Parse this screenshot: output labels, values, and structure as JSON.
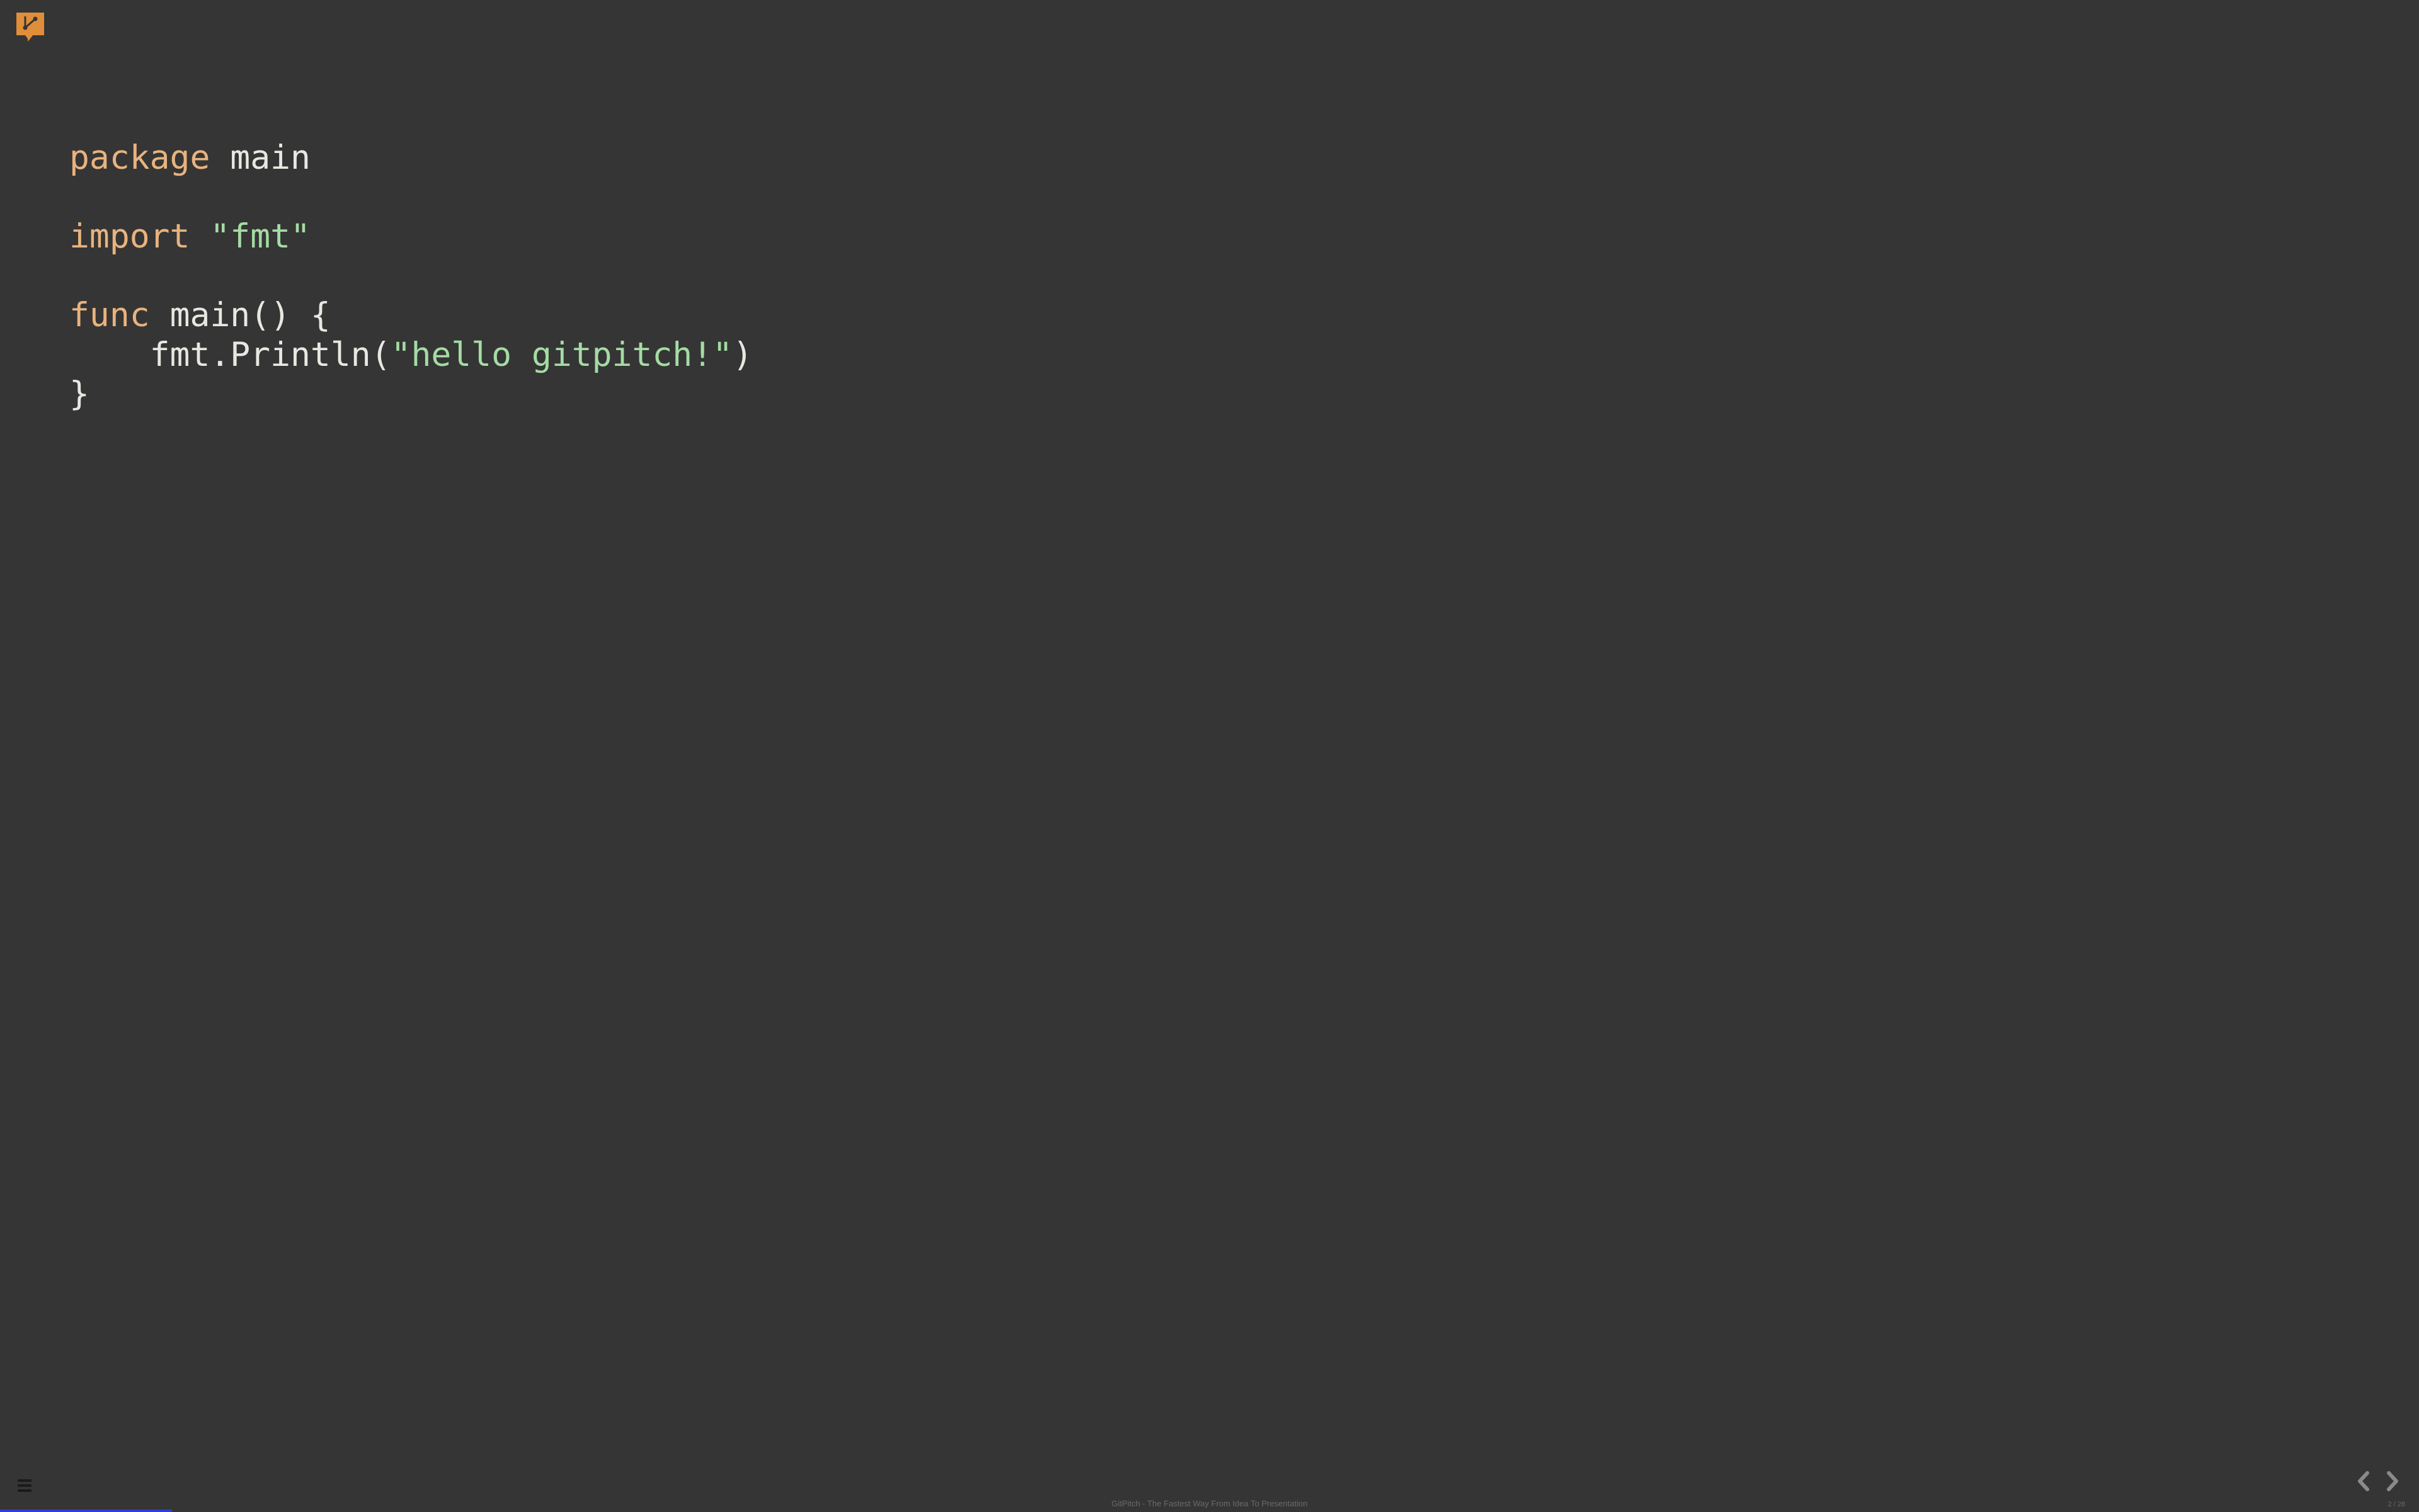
{
  "logo": {
    "name": "gitpitch-logo"
  },
  "code": {
    "tokens": [
      [
        {
          "t": "package",
          "c": "kw"
        },
        {
          "t": " ",
          "c": "fn"
        },
        {
          "t": "main",
          "c": "id"
        }
      ],
      [
        {
          "t": "",
          "c": "fn"
        }
      ],
      [
        {
          "t": "import",
          "c": "kw"
        },
        {
          "t": " ",
          "c": "fn"
        },
        {
          "t": "\"fmt\"",
          "c": "str"
        }
      ],
      [
        {
          "t": "",
          "c": "fn"
        }
      ],
      [
        {
          "t": "func",
          "c": "kw"
        },
        {
          "t": " ",
          "c": "fn"
        },
        {
          "t": "main",
          "c": "fn"
        },
        {
          "t": "() {",
          "c": "fn"
        }
      ],
      [
        {
          "t": "    fmt.Println(",
          "c": "fn"
        },
        {
          "t": "\"hello gitpitch!\"",
          "c": "str"
        },
        {
          "t": ")",
          "c": "fn"
        }
      ],
      [
        {
          "t": "}",
          "c": "fn"
        }
      ]
    ]
  },
  "footer": "GitPitch - The Fastest Way From Idea To Presentation",
  "page": {
    "current": 2,
    "total": 28,
    "display": "2 / 28"
  },
  "progress_percent": 7.1
}
